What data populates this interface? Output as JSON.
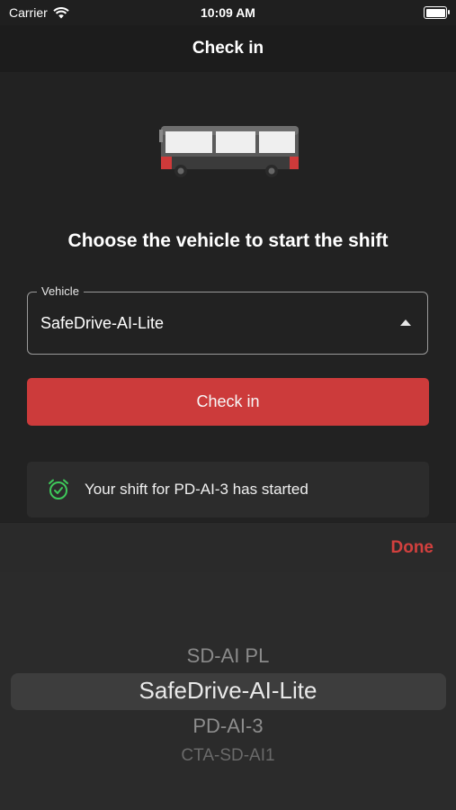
{
  "status_bar": {
    "carrier": "Carrier",
    "time": "10:09 AM",
    "battery_level": 1.0
  },
  "nav": {
    "title": "Check in"
  },
  "main": {
    "illustration_icon": "bus-icon",
    "heading": "Choose the vehicle to start the shift",
    "vehicle_field": {
      "label": "Vehicle",
      "value": "SafeDrive-AI-Lite"
    },
    "checkin_button_label": "Check in",
    "toast": {
      "icon": "alarm-clock-check-icon",
      "text": "Your shift for PD-AI-3 has started"
    }
  },
  "picker": {
    "done_label": "Done",
    "options": [
      "SD-AI PL",
      "SafeDrive-AI-Lite",
      "PD-AI-3",
      "CTA-SD-AI1"
    ],
    "selected": "SafeDrive-AI-Lite"
  },
  "colors": {
    "accent": "#cc3b3b",
    "done": "#d2403e",
    "toast_icon": "#3ec95a"
  }
}
